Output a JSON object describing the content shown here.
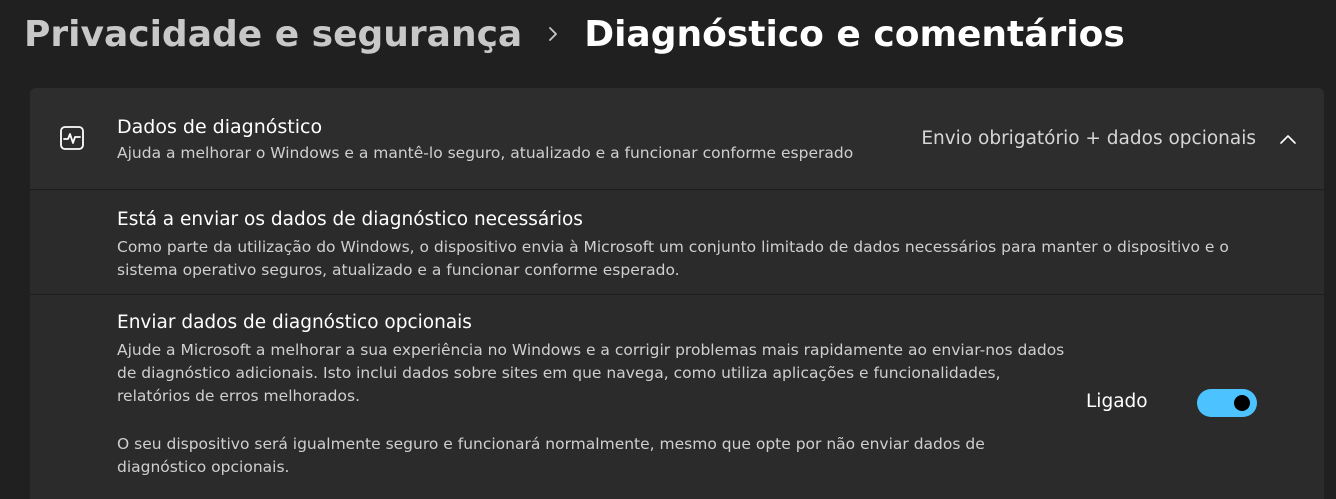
{
  "breadcrumb": {
    "parent": "Privacidade e segurança",
    "current": "Diagnóstico e comentários"
  },
  "diagnostics": {
    "icon": "activity-pulse-icon",
    "title": "Dados de diagnóstico",
    "description": "Ajuda a melhorar o Windows e a mantê-lo seguro, atualizado e a funcionar conforme esperado",
    "value": "Envio obrigatório + dados opcionais",
    "expanded": true
  },
  "required_row": {
    "title": "Está a enviar os dados de diagnóstico necessários",
    "description": "Como parte da utilização do Windows, o dispositivo envia à Microsoft um conjunto limitado de dados necessários para manter o dispositivo e o sistema operativo seguros, atualizado e a funcionar conforme esperado."
  },
  "optional_row": {
    "title": "Enviar dados de diagnóstico opcionais",
    "description": "Ajude a Microsoft a melhorar a sua experiência no Windows e a corrigir problemas mais rapidamente ao enviar-nos dados de diagnóstico adicionais. Isto inclui dados sobre sites em que navega, como utiliza aplicações e funcionalidades, relatórios de erros melhorados.",
    "note": "O seu dispositivo será igualmente seguro e funcionará normalmente, mesmo que opte por não enviar dados de diagnóstico opcionais.",
    "toggle_label": "Ligado",
    "toggle_on": true
  },
  "colors": {
    "background": "#202020",
    "card": "#2b2b2b",
    "accent": "#4cc2ff"
  }
}
